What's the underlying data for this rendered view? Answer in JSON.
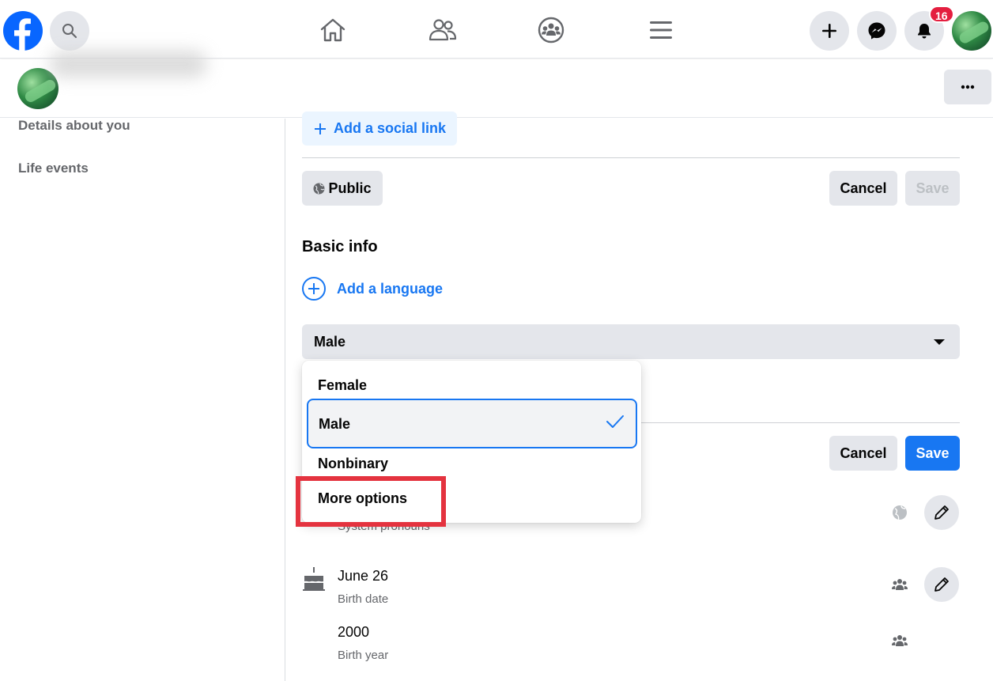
{
  "top_nav": {
    "notification_count": "16",
    "icons": [
      "facebook-logo",
      "search-icon",
      "home-icon",
      "friends-icon",
      "groups-icon",
      "menu-icon",
      "plus-icon",
      "messenger-icon",
      "bell-icon",
      "avatar"
    ]
  },
  "left_nav": {
    "items": [
      "Details about you",
      "Life events"
    ]
  },
  "contact": {
    "add_social_link": "Add a social link",
    "audience": "Public",
    "cancel": "Cancel",
    "save": "Save"
  },
  "basic_info": {
    "title": "Basic info",
    "add_language": "Add a language",
    "gender_value": "Male",
    "gender_options": [
      "Female",
      "Male",
      "Nonbinary",
      "More options"
    ],
    "selected_option": "Male",
    "cancel": "Cancel",
    "save": "Save",
    "pronouns_label": "System pronouns",
    "birth_date": "June 26",
    "birth_date_label": "Birth date",
    "birth_year": "2000",
    "birth_year_label": "Birth year"
  },
  "colors": {
    "brand_blue": "#1877f2",
    "highlight_red": "#e4333f",
    "button_gray": "#e4e6eb"
  }
}
